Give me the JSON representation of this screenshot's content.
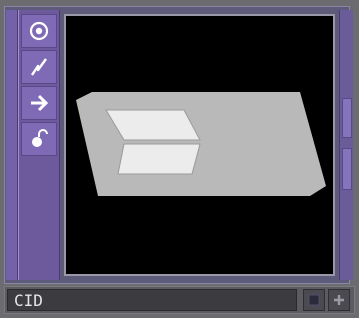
{
  "toolbar": {
    "tools": [
      {
        "icon": "target-icon"
      },
      {
        "icon": "lightning-icon"
      },
      {
        "icon": "arrow-right-icon"
      },
      {
        "icon": "unlock-icon"
      }
    ]
  },
  "viewport": {
    "background": "#000000",
    "plane_color": "#b4b4b4",
    "panel_color": "#e8e8e8"
  },
  "bottom_bar": {
    "name_value": "CID",
    "buttons": [
      {
        "icon": "square-icon"
      },
      {
        "icon": "plus-icon"
      }
    ]
  },
  "colors": {
    "accent": "#7f6bb5",
    "toolbar": "#6c5a9c"
  }
}
